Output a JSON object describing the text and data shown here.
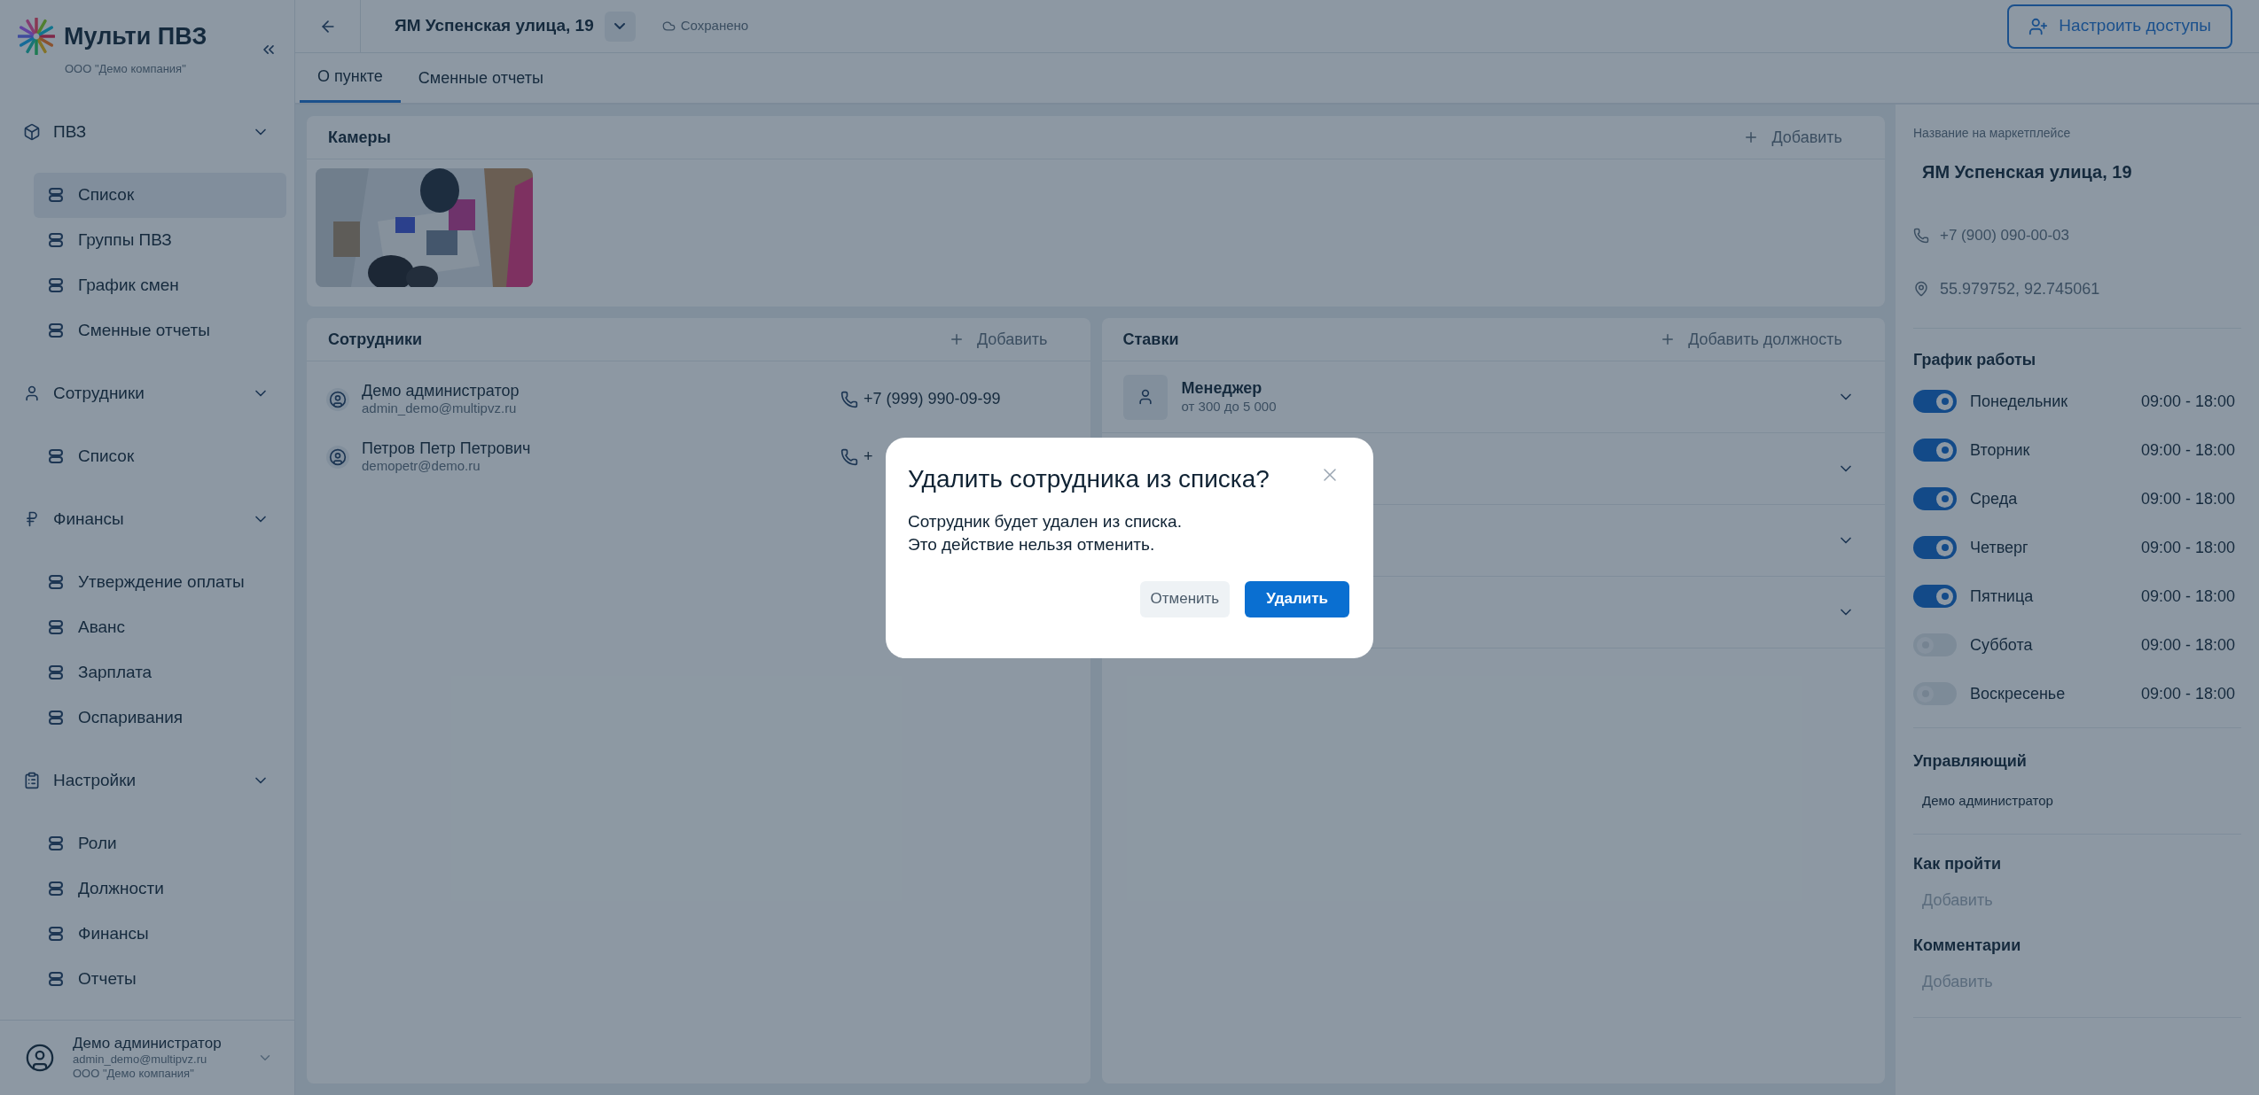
{
  "sidebar": {
    "logo_text": "Мульти ПВЗ",
    "company": "ООО \"Демо компания\"",
    "groups": [
      {
        "label": "ПВЗ",
        "expanded": true,
        "items": [
          {
            "label": "Список",
            "selected": true
          },
          {
            "label": "Группы ПВЗ",
            "selected": false
          },
          {
            "label": "График смен",
            "selected": false
          },
          {
            "label": "Сменные отчеты",
            "selected": false
          }
        ]
      },
      {
        "label": "Сотрудники",
        "expanded": true,
        "items": [
          {
            "label": "Список",
            "selected": false
          }
        ]
      },
      {
        "label": "Финансы",
        "expanded": true,
        "items": [
          {
            "label": "Утверждение оплаты",
            "selected": false
          },
          {
            "label": "Аванс",
            "selected": false
          },
          {
            "label": "Зарплата",
            "selected": false
          },
          {
            "label": "Оспаривания",
            "selected": false
          }
        ]
      },
      {
        "label": "Настройки",
        "expanded": true,
        "items": [
          {
            "label": "Роли",
            "selected": false
          },
          {
            "label": "Должности",
            "selected": false
          },
          {
            "label": "Финансы",
            "selected": false
          },
          {
            "label": "Отчеты",
            "selected": false
          }
        ]
      }
    ],
    "user": {
      "name": "Демо администратор",
      "email": "admin_demo@multipvz.ru",
      "company": "ООО \"Демо компания\""
    }
  },
  "header": {
    "title": "ЯМ Успенская улица, 19",
    "status": "Сохранено",
    "access_button": "Настроить доступы"
  },
  "tabs": [
    {
      "label": "О пункте",
      "selected": true
    },
    {
      "label": "Сменные отчеты",
      "selected": false
    }
  ],
  "cameras": {
    "title": "Камеры",
    "add": "Добавить"
  },
  "employees": {
    "title": "Сотрудники",
    "add": "Добавить",
    "rows": [
      {
        "name": "Демо администратор",
        "email": "admin_demo@multipvz.ru",
        "phone": "+7 (999) 990-09-99"
      },
      {
        "name": "Петров Петр Петрович",
        "email": "demopetr@demo.ru",
        "phone": "+"
      }
    ]
  },
  "rates": {
    "title": "Ставки",
    "add": "Добавить должность",
    "rows": [
      {
        "name": "Менеджер",
        "range": "от 300 до 5 000",
        "expanded": false
      },
      {
        "expanded": false
      },
      {
        "expanded": false
      },
      {
        "expanded": false
      }
    ]
  },
  "details": {
    "marketplace_label": "Название на маркетплейсе",
    "marketplace_name": "ЯМ Успенская улица, 19",
    "phone": "+7 (900) 090-00-03",
    "coordinates": "55.979752, 92.745061",
    "schedule": {
      "title": "График работы",
      "days": [
        {
          "day": "Понедельник",
          "on": true,
          "hours": "09:00 - 18:00"
        },
        {
          "day": "Вторник",
          "on": true,
          "hours": "09:00 - 18:00"
        },
        {
          "day": "Среда",
          "on": true,
          "hours": "09:00 - 18:00"
        },
        {
          "day": "Четверг",
          "on": true,
          "hours": "09:00 - 18:00"
        },
        {
          "day": "Пятница",
          "on": true,
          "hours": "09:00 - 18:00"
        },
        {
          "day": "Суббота",
          "on": false,
          "hours": "09:00 - 18:00"
        },
        {
          "day": "Воскресенье",
          "on": false,
          "hours": "09:00 - 18:00"
        }
      ]
    },
    "manager": {
      "title": "Управляющий",
      "value": "Демо администратор"
    },
    "directions": {
      "title": "Как пройти",
      "placeholder": "Добавить"
    },
    "comments": {
      "title": "Комментарии",
      "placeholder": "Добавить"
    }
  },
  "dialog": {
    "title": "Удалить сотрудника из списка?",
    "message_lines": [
      "Сотрудник будет удален из списка.",
      "Это действие нельзя отменить."
    ],
    "buttons": [
      {
        "label": "Отменить",
        "kind": "secondary"
      },
      {
        "label": "Удалить",
        "kind": "primary"
      }
    ]
  }
}
